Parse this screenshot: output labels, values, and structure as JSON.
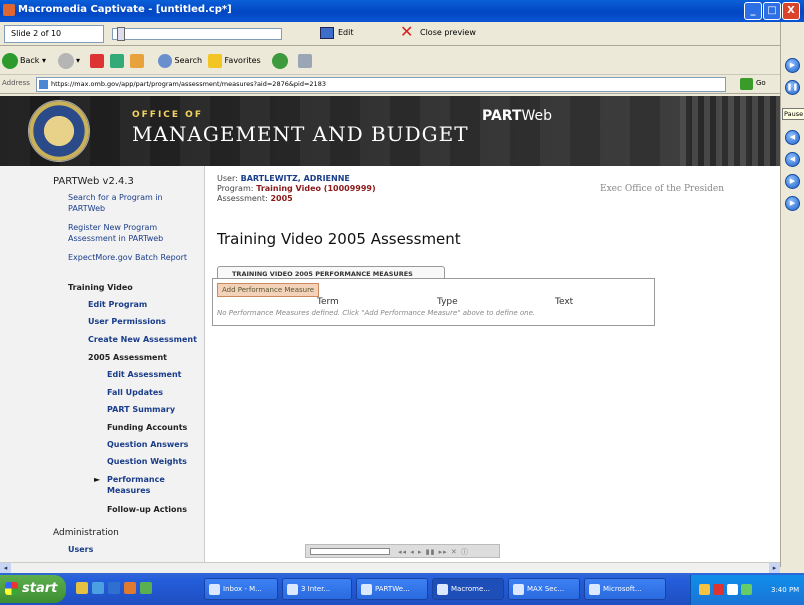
{
  "window": {
    "title": "Macromedia Captivate - [untitled.cp*]",
    "buttons": {
      "minimize": "_",
      "maximize": "□",
      "close": "X"
    }
  },
  "captivate": {
    "slide_indicator": "Slide 2 of 10",
    "edit_label": "Edit",
    "close_preview_label": "Close preview",
    "pause_label": "Pause"
  },
  "browser": {
    "back_label": "Back",
    "search_label": "Search",
    "favorites_label": "Favorites",
    "address_label": "Address",
    "url": "https://max.omb.gov/app/part/program/assessment/measures?aid=2876&pid=2183",
    "go_label": "Go"
  },
  "banner": {
    "office_of": "OFFICE OF",
    "agency": "MANAGEMENT AND BUDGET",
    "partweb_bold": "PART",
    "partweb_light": "Web"
  },
  "sidebar": {
    "version": "PARTWeb v2.4.3",
    "items": [
      {
        "label": "Search for a Program in PARTWeb"
      },
      {
        "label": "Register New Program Assessment in PARTweb"
      },
      {
        "label": "ExpectMore.gov Batch Report"
      },
      {
        "label": "Training Video"
      },
      {
        "label": "Edit Program"
      },
      {
        "label": "User Permissions"
      },
      {
        "label": "Create New Assessment"
      },
      {
        "label": "2005 Assessment"
      },
      {
        "label": "Edit Assessment"
      },
      {
        "label": "Fall Updates"
      },
      {
        "label": "PART Summary"
      },
      {
        "label": "Funding Accounts"
      },
      {
        "label": "Question Answers"
      },
      {
        "label": "Question Weights"
      },
      {
        "label": "Performance Measures"
      },
      {
        "label": "Follow-up Actions"
      },
      {
        "label": "Administration"
      },
      {
        "label": "Users"
      }
    ],
    "current_marker": "►"
  },
  "header": {
    "user_label": "User:",
    "user": "BARTLEWITZ, ADRIENNE",
    "program_label": "Program:",
    "program": "Training Video (10009999)",
    "assessment_label": "Assessment:",
    "assessment": "2005",
    "exec_office": "Exec Office of the Presiden"
  },
  "main": {
    "title": "Training Video 2005 Assessment",
    "tab_label": "TRAINING VIDEO 2005 PERFORMANCE MEASURES",
    "add_button": "Add Performance Measure",
    "columns": [
      "Term",
      "Type",
      "Text"
    ],
    "empty_message": "No Performance Measures defined. Click \"Add Performance Measure\" above to define one."
  },
  "taskbar": {
    "start_label": "start",
    "tasks": [
      {
        "label": "Inbox - M..."
      },
      {
        "label": "3 Inter..."
      },
      {
        "label": "PARTWe..."
      },
      {
        "label": "Macrome..."
      },
      {
        "label": "MAX Sec..."
      },
      {
        "label": "Microsoft..."
      }
    ],
    "clock": "3:40 PM"
  }
}
